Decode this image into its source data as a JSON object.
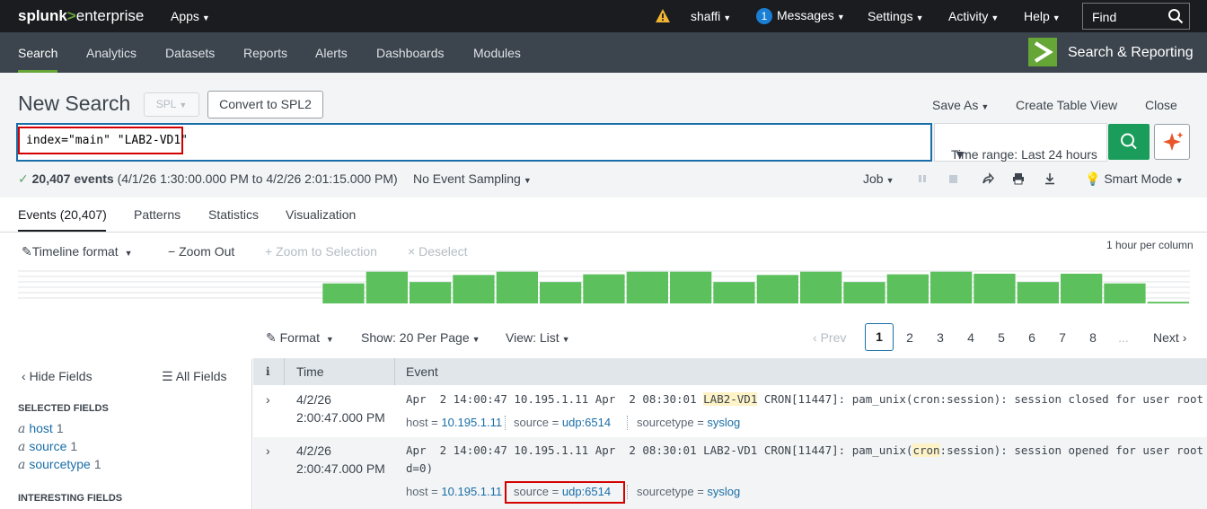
{
  "topbar": {
    "logo_bold": "splunk",
    "logo_gt": ">",
    "logo_rest": "enterprise",
    "apps": "Apps",
    "user": "shaffi",
    "messages_count": "1",
    "messages": "Messages",
    "settings": "Settings",
    "activity": "Activity",
    "help": "Help",
    "find": "Find"
  },
  "nav": {
    "tabs": [
      "Search",
      "Analytics",
      "Datasets",
      "Reports",
      "Alerts",
      "Dashboards",
      "Modules"
    ],
    "app_name": "Search & Reporting"
  },
  "search": {
    "title": "New Search",
    "spl": "SPL",
    "convert": "Convert to SPL2",
    "save_as": "Save As",
    "create_table": "Create Table View",
    "close": "Close",
    "query": "index=\"main\" \"LAB2-VD1\"",
    "time_range": "Time range: Last 24 hours"
  },
  "status": {
    "count": "20,407 events",
    "range": "(4/1/26 1:30:00.000 PM to 4/2/26 2:01:15.000 PM)",
    "sampling": "No Event Sampling",
    "job": "Job",
    "mode": "Smart Mode"
  },
  "result_tabs": [
    "Events (20,407)",
    "Patterns",
    "Statistics",
    "Visualization"
  ],
  "timeline": {
    "format": "Timeline format",
    "zoom_out": "Zoom Out",
    "zoom_selection": "Zoom to Selection",
    "deselect": "Deselect",
    "scale": "1 hour per column",
    "bars": [
      0,
      0,
      0,
      0,
      0,
      0,
      0,
      0.62,
      0.98,
      0.66,
      0.88,
      0.98,
      0.66,
      0.9,
      0.98,
      0.98,
      0.66,
      0.88,
      0.98,
      0.66,
      0.9,
      0.98,
      0.92,
      0.66,
      0.92,
      0.62,
      0.05
    ]
  },
  "pagination": {
    "format": "Format",
    "per_page": "Show: 20 Per Page",
    "view": "View: List",
    "prev": "Prev",
    "pages": [
      "1",
      "2",
      "3",
      "4",
      "5",
      "6",
      "7",
      "8"
    ],
    "ellipsis": "...",
    "next": "Next"
  },
  "sidebar": {
    "hide_fields": "Hide Fields",
    "all_fields": "All Fields",
    "selected_header": "SELECTED FIELDS",
    "selected": [
      {
        "type": "a",
        "name": "host",
        "count": "1"
      },
      {
        "type": "a",
        "name": "source",
        "count": "1"
      },
      {
        "type": "a",
        "name": "sourcetype",
        "count": "1"
      }
    ],
    "interesting_header": "INTERESTING FIELDS"
  },
  "table": {
    "col_info": "i",
    "col_time": "Time",
    "col_event": "Event",
    "events": [
      {
        "date": "4/2/26",
        "time": "2:00:47.000 PM",
        "raw_pre": "Apr  2 14:00:47 10.195.1.11 Apr  2 08:30:01 ",
        "raw_hl": "LAB2-VD1",
        "raw_post": " CRON[11447]: pam_unix(cron:session): session closed for user root",
        "host_label": "host =",
        "host": "10.195.1.11",
        "source_label": "source =",
        "source": "udp:6514",
        "sourcetype_label": "sourcetype =",
        "sourcetype": "syslog"
      },
      {
        "date": "4/2/26",
        "time": "2:00:47.000 PM",
        "raw_pre": "Apr  2 14:00:47 10.195.1.11 Apr  2 08:30:01 LAB2-VD1 CRON[11447]: pam_unix(",
        "raw_hl": "cron",
        "raw_post": ":session): session opened for user root by (ui",
        "raw_line2": "d=0)",
        "host_label": "host =",
        "host": "10.195.1.11",
        "source_label": "source =",
        "source": "udp:6514",
        "sourcetype_label": "sourcetype =",
        "sourcetype": "syslog"
      }
    ]
  },
  "colors": {
    "accent_green": "#65a637",
    "search_button": "#1a9d5a",
    "highlight_red": "#d40000",
    "link_blue": "#1a6ea8"
  }
}
